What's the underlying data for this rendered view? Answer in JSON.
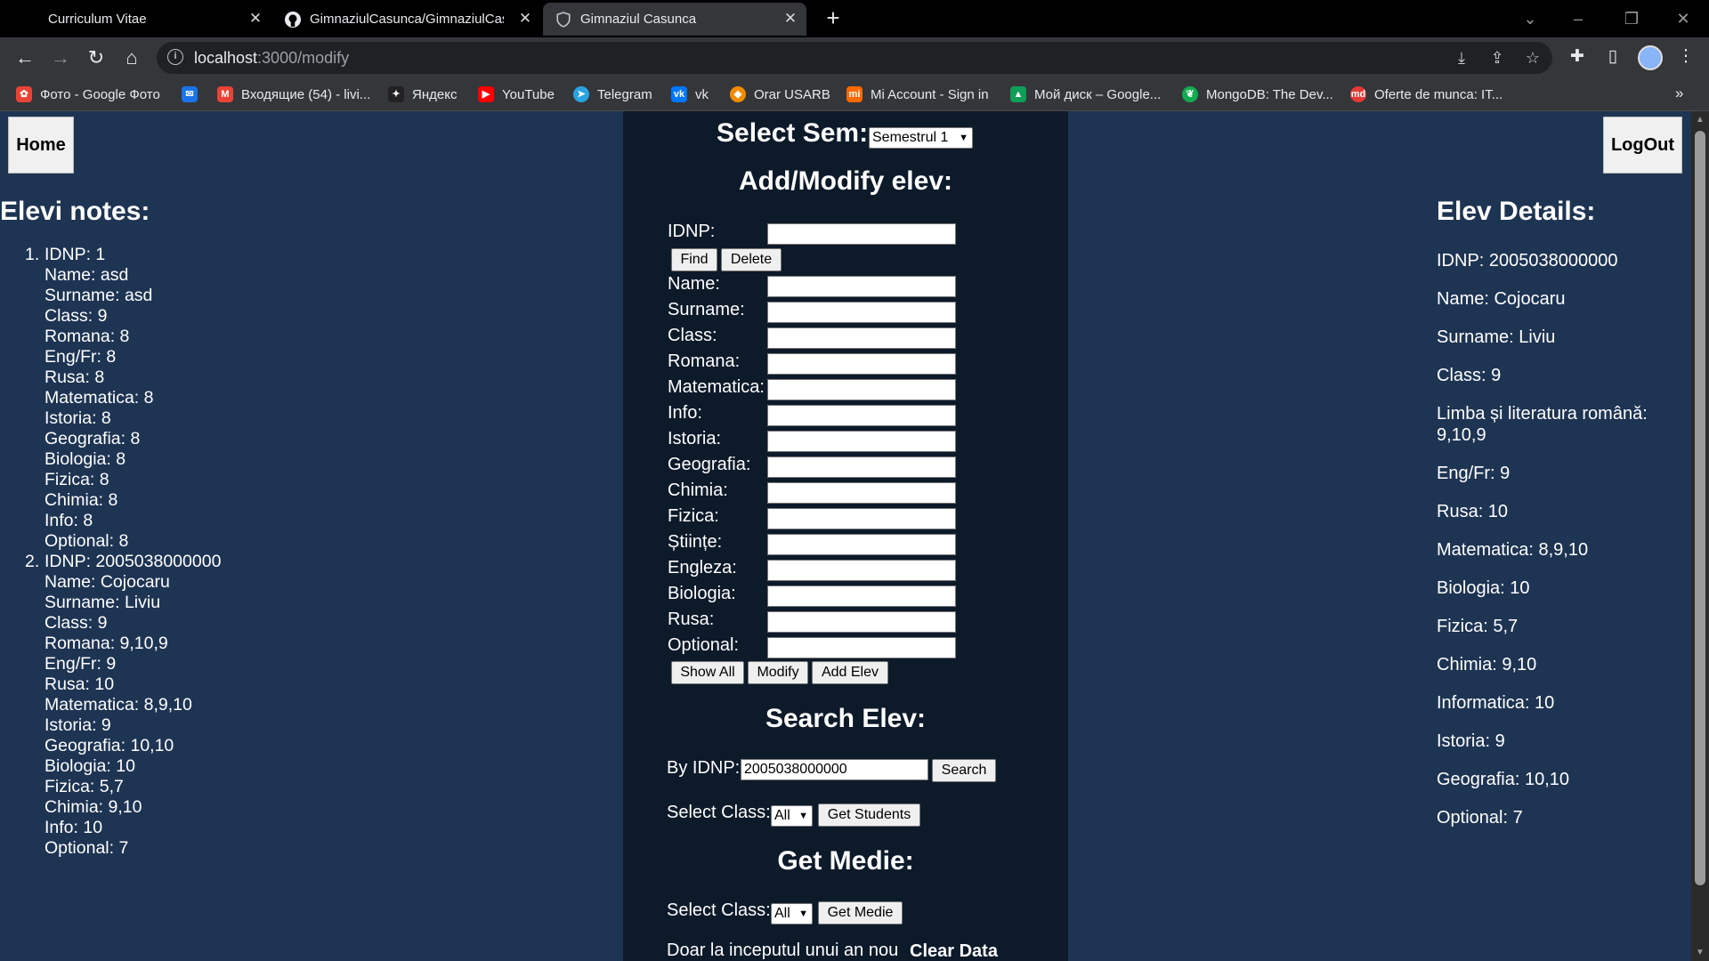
{
  "browser": {
    "tabs": [
      {
        "title": "Curriculum Vitae",
        "active": false
      },
      {
        "title": "GimnaziulCasunca/GimnaziulCas",
        "active": false
      },
      {
        "title": "Gimnaziul Casunca",
        "active": true
      }
    ],
    "url_host": "localhost",
    "url_path": ":3000/modify",
    "bookmarks": [
      {
        "label": "Фото - Google Фото",
        "color": "#ea4335"
      },
      {
        "label": "",
        "color": "#1a73e8"
      },
      {
        "label": "Входящие (54) - livi...",
        "color": "#ea4335"
      },
      {
        "label": "Яндекс",
        "color": "#222222"
      },
      {
        "label": "YouTube",
        "color": "#ff0000"
      },
      {
        "label": "Telegram",
        "color": "#2aa3e0"
      },
      {
        "label": "vk",
        "color": "#0077ff"
      },
      {
        "label": "Orar USARB",
        "color": "#f08c00"
      },
      {
        "label": "Mi Account - Sign in",
        "color": "#ff6900"
      },
      {
        "label": "Мой диск – Google...",
        "color": "#0f9d58"
      },
      {
        "label": "MongoDB: The Dev...",
        "color": "#13aa52"
      },
      {
        "label": "Oferte de munca: IT...",
        "color": "#e53935"
      }
    ]
  },
  "page": {
    "home_label": "Home",
    "logout_label": "LogOut",
    "left_heading": "Elevi notes:",
    "students": [
      {
        "num": "1.",
        "lines": [
          "IDNP: 1",
          "Name: asd",
          "Surname: asd",
          "Class: 9",
          "Romana: 8",
          "Eng/Fr: 8",
          "Rusa: 8",
          "Matematica: 8",
          "Istoria: 8",
          "Geografia: 8",
          "Biologia: 8",
          "Fizica: 8",
          "Chimia: 8",
          "Info: 8",
          "Optional: 8"
        ]
      },
      {
        "num": "2.",
        "lines": [
          "IDNP: 2005038000000",
          "Name: Cojocaru",
          "Surname: Liviu",
          "Class: 9",
          "Romana: 9,10,9",
          "Eng/Fr: 9",
          "Rusa: 10",
          "Matematica: 8,9,10",
          "Istoria: 9",
          "Geografia: 10,10",
          "Biologia: 10",
          "Fizica: 5,7",
          "Chimia: 9,10",
          "Info: 10",
          "Optional: 7"
        ]
      }
    ],
    "select_sem_label": "Select Sem:",
    "semester_value": "Semestrul 1",
    "add_modify_heading": "Add/Modify elev:",
    "idnp_label": "IDNP:",
    "find_label": "Find",
    "delete_label": "Delete",
    "fields": [
      "Name:",
      "Surname:",
      "Class:",
      "Romana:",
      "Matematica:",
      "Info:",
      "Istoria:",
      "Geografia:",
      "Chimia:",
      "Fizica:",
      "Științe:",
      "Engleza:",
      "Biologia:",
      "Rusa:",
      "Optional:"
    ],
    "show_all_label": "Show All",
    "modify_label": "Modify",
    "add_elev_label": "Add Elev",
    "search_heading": "Search Elev:",
    "by_idnp_label": "By IDNP:",
    "search_value": "2005038000000",
    "search_label": "Search",
    "select_class_label": "Select Class:",
    "class_value": "All",
    "get_students_label": "Get Students",
    "get_medie_heading": "Get Medie:",
    "get_medie_label": "Get Medie",
    "clear_text": "Doar la inceputul unui an nou",
    "clear_label": "Clear Data",
    "right_heading": "Elev Details:",
    "details": [
      "IDNP: 2005038000000",
      "Name: Cojocaru",
      "Surname: Liviu",
      "Class: 9",
      "Limba și literatura română: 9,10,9",
      "Eng/Fr: 9",
      "Rusa: 10",
      "Matematica: 8,9,10",
      "Biologia: 10",
      "Fizica: 5,7",
      "Chimia: 9,10",
      "Informatica: 10",
      "Istoria: 9",
      "Geografia: 10,10",
      "Optional: 7"
    ]
  }
}
